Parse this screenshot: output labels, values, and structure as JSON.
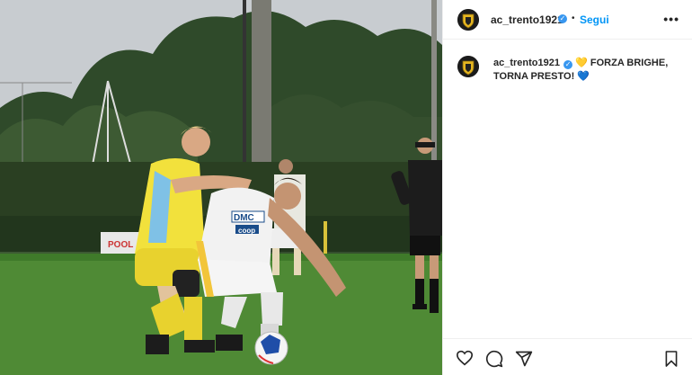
{
  "post": {
    "username": "ac_trento1921",
    "follow_label": "Segui",
    "more_label": "•••",
    "separator": "•",
    "caption": {
      "username": "ac_trento1921",
      "text_line1": "FORZA BRIGHE,",
      "text_line2": "TORNA PRESTO!",
      "emoji_yellow_heart": "💛",
      "emoji_blue_heart": "💙"
    }
  },
  "photo": {
    "jersey_sponsor": "DMC",
    "sponsor_2": "coop",
    "board_text": "POOL"
  },
  "icons": {
    "like": "heart-icon",
    "comment": "comment-icon",
    "share": "send-icon",
    "save": "bookmark-icon",
    "verified": "verified-badge-icon"
  },
  "colors": {
    "link": "#0095f6",
    "verified": "#3897f0",
    "text": "#262626"
  }
}
